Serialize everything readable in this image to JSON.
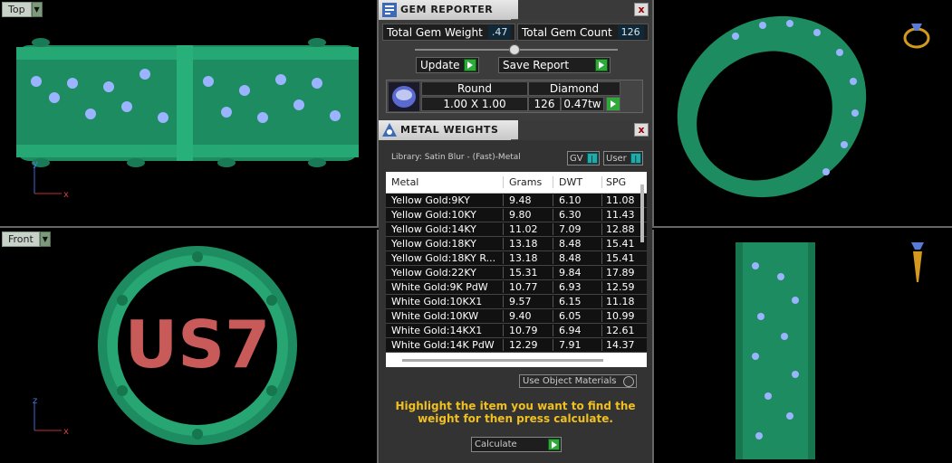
{
  "viewports": {
    "top_label": "Top",
    "front_label": "Front",
    "top_axes": {
      "y": "y",
      "x": "x"
    },
    "front_axes": {
      "z": "z",
      "x": "x"
    },
    "front_text": "US7"
  },
  "gem_reporter": {
    "title": "GEM REPORTER",
    "close": "x",
    "total_weight_label": "Total Gem Weight",
    "total_weight_value": ".47",
    "total_count_label": "Total Gem Count",
    "total_count_value": "126",
    "update_label": "Update",
    "save_report_label": "Save Report",
    "gem": {
      "shape": "Round",
      "material": "Diamond",
      "size": "1.00 X 1.00",
      "count": "126",
      "weight": "0.47tw"
    }
  },
  "metal_weights": {
    "title": "METAL WEIGHTS",
    "close": "x",
    "library": "Library: Satin Blur - (Fast)-Metal",
    "gv_label": "GV",
    "user_label": "User",
    "columns": [
      "Metal",
      "Grams",
      "DWT",
      "SPG"
    ],
    "rows": [
      [
        "Yellow Gold:9KY",
        "9.48",
        "6.10",
        "11.08"
      ],
      [
        "Yellow Gold:10KY",
        "9.80",
        "6.30",
        "11.43"
      ],
      [
        "Yellow Gold:14KY",
        "11.02",
        "7.09",
        "12.88"
      ],
      [
        "Yellow Gold:18KY",
        "13.18",
        "8.48",
        "15.41"
      ],
      [
        "Yellow Gold:18KY R...",
        "13.18",
        "8.48",
        "15.41"
      ],
      [
        "Yellow Gold:22KY",
        "15.31",
        "9.84",
        "17.89"
      ],
      [
        "White Gold:9K PdW",
        "10.77",
        "6.93",
        "12.59"
      ],
      [
        "White Gold:10KX1",
        "9.57",
        "6.15",
        "11.18"
      ],
      [
        "White Gold:10KW",
        "9.40",
        "6.05",
        "10.99"
      ],
      [
        "White Gold:14KX1",
        "10.79",
        "6.94",
        "12.61"
      ],
      [
        "White Gold:14K PdW",
        "12.29",
        "7.91",
        "14.37"
      ]
    ],
    "use_object_materials": "Use Object Materials",
    "hint": "Highlight the item you want to find the weight for then press calculate.",
    "calculate_label": "Calculate"
  },
  "colors": {
    "ring_green": "#1f9a6a",
    "gem_blue": "#8fa8ff",
    "hint_yellow": "#f0c020",
    "go_green": "#2faa3a"
  }
}
